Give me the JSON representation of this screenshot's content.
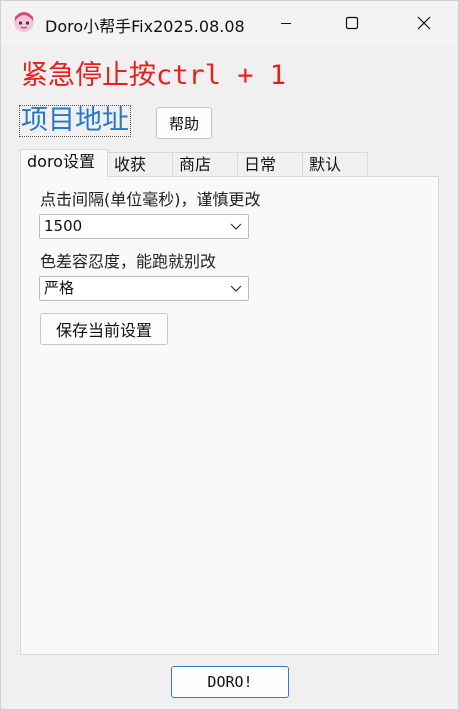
{
  "window": {
    "title": "Doro小帮手Fix2025.08.08",
    "icon": "anime-avatar-icon"
  },
  "header": {
    "stop_hint": "紧急停止按ctrl + 1",
    "project_link": "项目地址",
    "help_label": "帮助"
  },
  "tabs": [
    {
      "label": "doro设置",
      "active": true
    },
    {
      "label": "收获"
    },
    {
      "label": "商店"
    },
    {
      "label": "日常"
    },
    {
      "label": "默认"
    }
  ],
  "settings": {
    "click_interval_label": "点击间隔(单位毫秒)，谨慎更改",
    "click_interval_value": "1500",
    "tolerance_label": "色差容忍度，能跑就别改",
    "tolerance_value": "严格",
    "save_label": "保存当前设置"
  },
  "footer": {
    "doro_label": "DORO!"
  },
  "colors": {
    "stop_text": "#e8201c",
    "link": "#2678c9",
    "accent_border": "#3a78c3"
  }
}
